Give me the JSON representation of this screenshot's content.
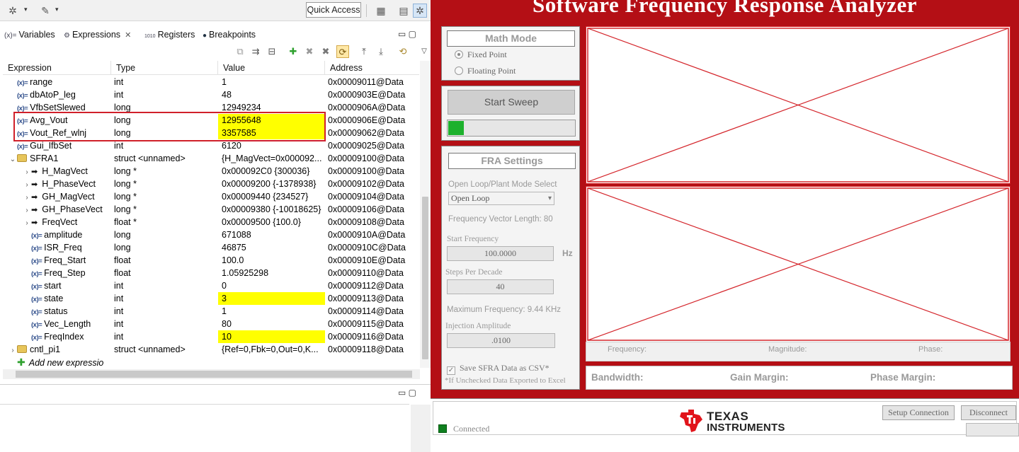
{
  "ide": {
    "quick_access": "Quick Access",
    "tabs": [
      {
        "icon": "(x)=",
        "label": "Variables"
      },
      {
        "icon": "",
        "label": "Expressions"
      },
      {
        "icon": "1010",
        "label": "Registers"
      },
      {
        "icon": "",
        "label": "Breakpoints"
      }
    ],
    "columns": [
      "Expression",
      "Type",
      "Value",
      "Address"
    ],
    "rows": [
      {
        "indent": 0,
        "twisty": "",
        "kind": "var",
        "name": "range",
        "type": "int",
        "value": "1",
        "address": "0x00009011@Data",
        "hl": false
      },
      {
        "indent": 0,
        "twisty": "",
        "kind": "var",
        "name": "dbAtoP_leg",
        "type": "int",
        "value": "48",
        "address": "0x0000903E@Data",
        "hl": false
      },
      {
        "indent": 0,
        "twisty": "",
        "kind": "var",
        "name": "VfbSetSlewed",
        "type": "long",
        "value": "12949234",
        "address": "0x0000906A@Data",
        "hl": false
      },
      {
        "indent": 0,
        "twisty": "",
        "kind": "var",
        "name": "Avg_Vout",
        "type": "long",
        "value": "12955648",
        "address": "0x0000906E@Data",
        "hl": true
      },
      {
        "indent": 0,
        "twisty": "",
        "kind": "var",
        "name": "Vout_Ref_wlnj",
        "type": "long",
        "value": "3357585",
        "address": "0x00009062@Data",
        "hl": true
      },
      {
        "indent": 0,
        "twisty": "",
        "kind": "var",
        "name": "Gui_IfbSet",
        "type": "int",
        "value": "6120",
        "address": "0x00009025@Data",
        "hl": false
      },
      {
        "indent": 0,
        "twisty": "open",
        "kind": "struct",
        "name": "SFRA1",
        "type": "struct <unnamed>",
        "value": "{H_MagVect=0x000092...",
        "address": "0x00009100@Data",
        "hl": false
      },
      {
        "indent": 1,
        "twisty": "closed",
        "kind": "ptr",
        "name": "H_MagVect",
        "type": "long *",
        "value": "0x000092C0 {300036}",
        "address": "0x00009100@Data",
        "hl": false
      },
      {
        "indent": 1,
        "twisty": "closed",
        "kind": "ptr",
        "name": "H_PhaseVect",
        "type": "long *",
        "value": "0x00009200 {-1378938}",
        "address": "0x00009102@Data",
        "hl": false
      },
      {
        "indent": 1,
        "twisty": "closed",
        "kind": "ptr",
        "name": "GH_MagVect",
        "type": "long *",
        "value": "0x00009440 {234527}",
        "address": "0x00009104@Data",
        "hl": false
      },
      {
        "indent": 1,
        "twisty": "closed",
        "kind": "ptr",
        "name": "GH_PhaseVect",
        "type": "long *",
        "value": "0x00009380 {-10018625}",
        "address": "0x00009106@Data",
        "hl": false
      },
      {
        "indent": 1,
        "twisty": "closed",
        "kind": "ptr",
        "name": "FreqVect",
        "type": "float *",
        "value": "0x00009500 {100.0}",
        "address": "0x00009108@Data",
        "hl": false
      },
      {
        "indent": 1,
        "twisty": "",
        "kind": "var",
        "name": "amplitude",
        "type": "long",
        "value": "671088",
        "address": "0x0000910A@Data",
        "hl": false
      },
      {
        "indent": 1,
        "twisty": "",
        "kind": "var",
        "name": "ISR_Freq",
        "type": "long",
        "value": "46875",
        "address": "0x0000910C@Data",
        "hl": false
      },
      {
        "indent": 1,
        "twisty": "",
        "kind": "var",
        "name": "Freq_Start",
        "type": "float",
        "value": "100.0",
        "address": "0x0000910E@Data",
        "hl": false
      },
      {
        "indent": 1,
        "twisty": "",
        "kind": "var",
        "name": "Freq_Step",
        "type": "float",
        "value": "1.05925298",
        "address": "0x00009110@Data",
        "hl": false
      },
      {
        "indent": 1,
        "twisty": "",
        "kind": "var",
        "name": "start",
        "type": "int",
        "value": "0",
        "address": "0x00009112@Data",
        "hl": false
      },
      {
        "indent": 1,
        "twisty": "",
        "kind": "var",
        "name": "state",
        "type": "int",
        "value": "3",
        "address": "0x00009113@Data",
        "hl": true
      },
      {
        "indent": 1,
        "twisty": "",
        "kind": "var",
        "name": "status",
        "type": "int",
        "value": "1",
        "address": "0x00009114@Data",
        "hl": false
      },
      {
        "indent": 1,
        "twisty": "",
        "kind": "var",
        "name": "Vec_Length",
        "type": "int",
        "value": "80",
        "address": "0x00009115@Data",
        "hl": false
      },
      {
        "indent": 1,
        "twisty": "",
        "kind": "var",
        "name": "FreqIndex",
        "type": "int",
        "value": "10",
        "address": "0x00009116@Data",
        "hl": true
      },
      {
        "indent": 0,
        "twisty": "closed",
        "kind": "struct",
        "name": "cntl_pi1",
        "type": "struct <unnamed>",
        "value": "{Ref=0,Fbk=0,Out=0,K...",
        "address": "0x00009118@Data",
        "hl": false
      },
      {
        "indent": 0,
        "twisty": "",
        "kind": "add",
        "name": "Add new expressio",
        "type": "",
        "value": "",
        "address": "",
        "hl": false
      }
    ],
    "var_icon": "(x)="
  },
  "sfra": {
    "title": "Software Frequency Response Analyzer",
    "math_mode": {
      "title": "Math Mode",
      "options": [
        "Fixed Point",
        "Floating Point"
      ],
      "selected": 0
    },
    "start_sweep": "Start Sweep",
    "progress": 0.12,
    "settings": {
      "title": "FRA Settings",
      "mode_label": "Open Loop/Plant Mode Select",
      "mode_value": "Open Loop",
      "freq_vec_len_label": "Frequency Vector Length: 80",
      "start_freq_label": "Start Frequency",
      "start_freq_value": "100.0000",
      "start_freq_unit": "Hz",
      "steps_label": "Steps Per Decade",
      "steps_value": "40",
      "max_freq_label": "Maximum Frequency: 9.44 KHz",
      "inj_amp_label": "Injection Amplitude",
      "inj_amp_value": ".0100",
      "save_csv_label": "Save SFRA Data as CSV*",
      "footnote": "*If Unchecked Data Exported to Excel"
    },
    "readout": {
      "frequency": "Frequency:",
      "magnitude": "Magnitude:",
      "phase": "Phase:"
    },
    "margins": {
      "bandwidth": "Bandwidth:",
      "gain_margin": "Gain Margin:",
      "phase_margin": "Phase Margin:"
    },
    "setup_connection": "Setup Connection",
    "disconnect": "Disconnect",
    "connection_status": "Connected",
    "logo_line1": "Texas",
    "logo_line2": "Instruments",
    "colors": {
      "app_red": "#b40f15",
      "plot_border": "#d4242a",
      "progress": "#1db12d",
      "highlight": "#ffff00"
    }
  }
}
